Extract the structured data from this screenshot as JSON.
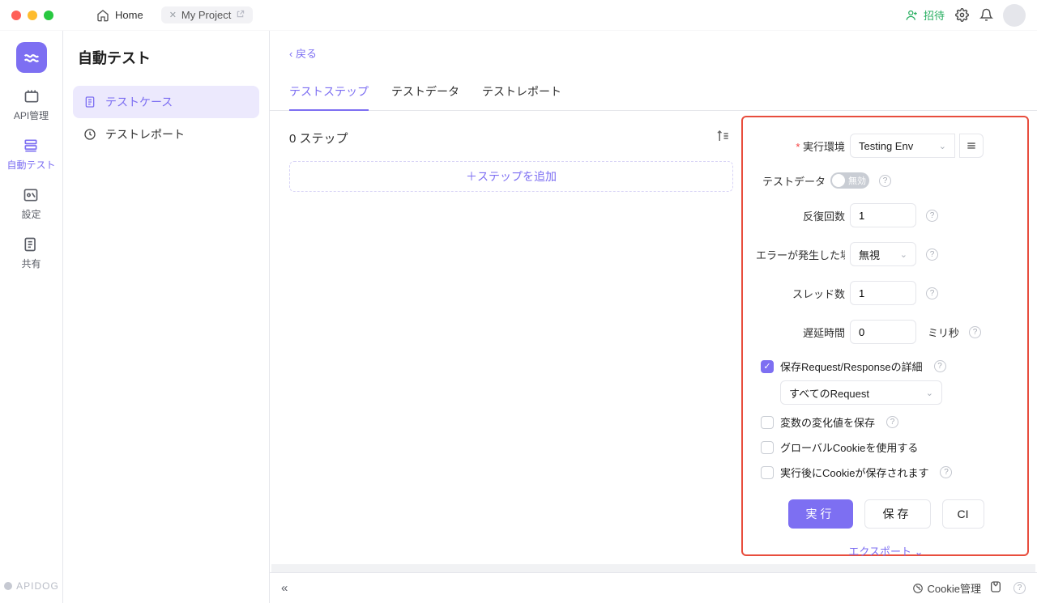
{
  "titlebar": {
    "home": "Home",
    "project_tab": "My Project",
    "invite": "招待"
  },
  "rail": {
    "api_mgmt": "API管理",
    "auto_test": "自動テスト",
    "settings": "設定",
    "share": "共有",
    "brand": "APIDOG"
  },
  "sidebar": {
    "title": "自動テスト",
    "items": [
      {
        "label": "テストケース"
      },
      {
        "label": "テストレポート"
      }
    ]
  },
  "main": {
    "back": "戻る",
    "tabs": [
      {
        "label": "テストステップ"
      },
      {
        "label": "テストデータ"
      },
      {
        "label": "テストレポート"
      }
    ],
    "step_count": "0 ステップ",
    "add_step": "ステップを追加"
  },
  "settings": {
    "env_label": "実行環境",
    "env_value": "Testing Env",
    "testdata_label": "テストデータ",
    "testdata_toggle": "無効",
    "iterations_label": "反復回数",
    "iterations_value": "1",
    "on_error_label": "エラーが発生した場",
    "on_error_value": "無視",
    "threads_label": "スレッド数",
    "threads_value": "1",
    "delay_label": "遅延時間",
    "delay_value": "0",
    "delay_unit": "ミリ秒",
    "save_reqres": "保存Request/Responseの詳細",
    "reqres_scope": "すべてのRequest",
    "save_vars": "変数の変化値を保存",
    "use_global_cookie": "グローバルCookieを使用する",
    "save_cookie_after": "実行後にCookieが保存されます",
    "run_btn": "実行",
    "save_btn": "保存",
    "ci_btn": "CI",
    "export": "エクスポート"
  },
  "bottombar": {
    "cookie_mgmt": "Cookie管理"
  }
}
